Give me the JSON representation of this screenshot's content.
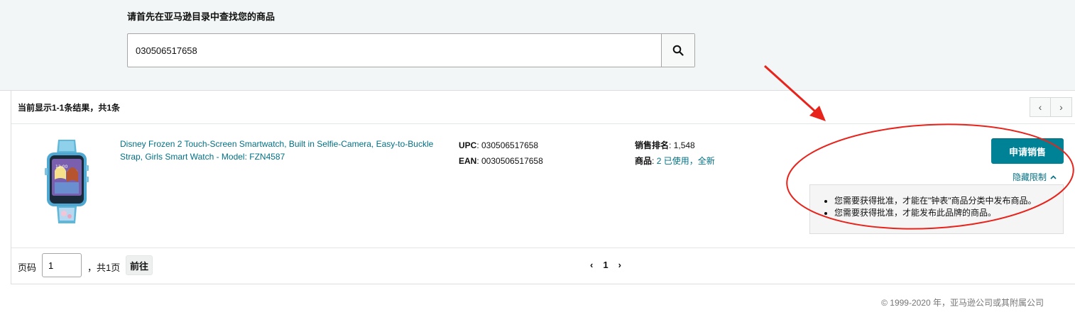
{
  "search": {
    "title": "请首先在亚马逊目录中查找您的商品",
    "query": "030506517658"
  },
  "results": {
    "count_text": "当前显示1-1条结果，共1条",
    "prev_arrow": "‹",
    "next_arrow": "›"
  },
  "product": {
    "title": "Disney Frozen 2 Touch-Screen Smartwatch, Built in Selfie-Camera, Easy-to-Buckle Strap, Girls Smart Watch - Model: FZN4587",
    "upc_label": "UPC",
    "upc_value": ": 030506517658",
    "ean_label": "EAN",
    "ean_value": ": 0030506517658",
    "rank_label": "销售排名",
    "rank_value": ": 1,548",
    "offers_label": "商品",
    "offers_sep": ": ",
    "offers_used": "2 已使用",
    "offers_comma": "，",
    "offers_new": "全新",
    "apply_button": "申请销售",
    "hide_restrictions": "隐藏限制",
    "restrictions": [
      "您需要获得批准，才能在\"钟表\"商品分类中发布商品。",
      "您需要获得批准，才能发布此品牌的商品。"
    ]
  },
  "pagination": {
    "page_label": "页码",
    "page_value": "1",
    "total_text": "，共1页",
    "go_button": "前往",
    "prev": "‹",
    "current": "1",
    "next": "›"
  },
  "footer": {
    "copyright": "© 1999-2020 年，亚马逊公司或其附属公司"
  },
  "colors": {
    "accent": "#008296",
    "link": "#007185",
    "annotation": "#e8231b"
  }
}
